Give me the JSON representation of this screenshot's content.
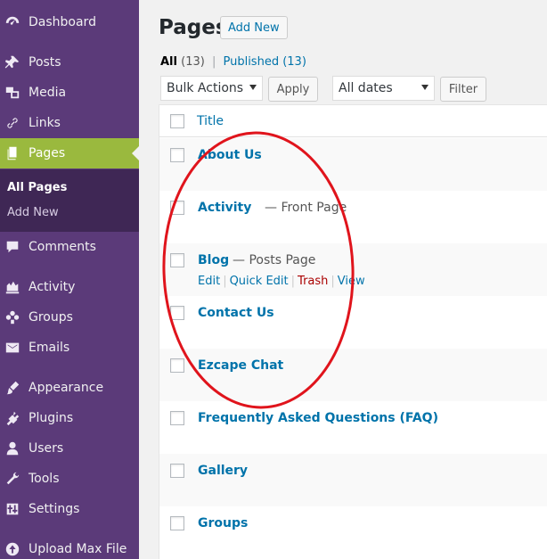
{
  "sidebar": {
    "items": [
      {
        "label": "Dashboard",
        "icon": "dashboard-icon"
      },
      {
        "label": "Posts",
        "icon": "pin-icon"
      },
      {
        "label": "Media",
        "icon": "media-icon"
      },
      {
        "label": "Links",
        "icon": "link-icon"
      },
      {
        "label": "Pages",
        "icon": "pages-icon"
      },
      {
        "label": "Comments",
        "icon": "comment-icon"
      },
      {
        "label": "Activity",
        "icon": "activity-icon"
      },
      {
        "label": "Groups",
        "icon": "groups-icon"
      },
      {
        "label": "Emails",
        "icon": "email-icon"
      },
      {
        "label": "Appearance",
        "icon": "brush-icon"
      },
      {
        "label": "Plugins",
        "icon": "plugin-icon"
      },
      {
        "label": "Users",
        "icon": "user-icon"
      },
      {
        "label": "Tools",
        "icon": "wrench-icon"
      },
      {
        "label": "Settings",
        "icon": "settings-icon"
      },
      {
        "label": "Upload Max File",
        "icon": "upload-icon"
      }
    ],
    "submenu": {
      "all_pages": "All Pages",
      "add_new": "Add New"
    }
  },
  "header": {
    "title": "Pages",
    "add_new": "Add New"
  },
  "views": {
    "all": "All",
    "all_count": "(13)",
    "separator": "|",
    "published": "Published",
    "published_count": "(13)"
  },
  "filters": {
    "bulk_actions": "Bulk Actions",
    "apply": "Apply",
    "all_dates": "All dates",
    "filter": "Filter"
  },
  "table": {
    "column_title": "Title",
    "rows": [
      {
        "title": "About Us",
        "state": ""
      },
      {
        "title": "Activity",
        "state": "— Front Page"
      },
      {
        "title": "Blog",
        "state": "— Posts Page"
      },
      {
        "title": "Contact Us",
        "state": ""
      },
      {
        "title": "Ezcape Chat",
        "state": ""
      },
      {
        "title": "Frequently Asked Questions (FAQ)",
        "state": ""
      },
      {
        "title": "Gallery",
        "state": ""
      },
      {
        "title": "Groups",
        "state": ""
      }
    ],
    "row_actions": {
      "edit": "Edit",
      "quick_edit": "Quick Edit",
      "trash": "Trash",
      "view": "View",
      "separator": "|"
    }
  },
  "colors": {
    "sidebar": "#5b3a79",
    "active": "#9ab93e",
    "link": "#0073aa",
    "annotation": "#e0141c"
  }
}
